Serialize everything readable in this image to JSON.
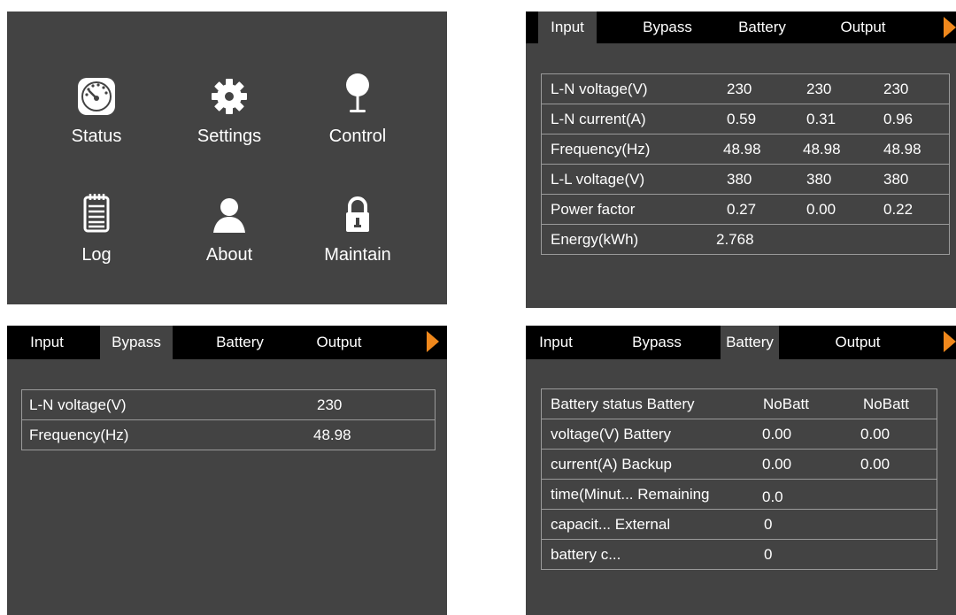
{
  "menu": {
    "items": [
      {
        "label": "Status",
        "icon": "gauge-icon"
      },
      {
        "label": "Settings",
        "icon": "gear-icon"
      },
      {
        "label": "Control",
        "icon": "joystick-icon"
      },
      {
        "label": "Log",
        "icon": "notepad-icon"
      },
      {
        "label": "About",
        "icon": "user-icon"
      },
      {
        "label": "Maintain",
        "icon": "lock-icon"
      }
    ]
  },
  "tabs": [
    "Input",
    "Bypass",
    "Battery",
    "Output"
  ],
  "accent_color": "#f0881c",
  "input_screen": {
    "active_tab": "Input",
    "rows": [
      {
        "label": "L-N voltage(V)",
        "values": [
          "230",
          "230",
          "230"
        ]
      },
      {
        "label": "L-N current(A)",
        "values": [
          "0.59",
          "0.31",
          "0.96"
        ]
      },
      {
        "label": "Frequency(Hz)",
        "values": [
          "48.98",
          "48.98",
          "48.98"
        ]
      },
      {
        "label": "L-L voltage(V)",
        "values": [
          "380",
          "380",
          "380"
        ]
      },
      {
        "label": "Power factor",
        "values": [
          "0.27",
          "0.00",
          "0.22"
        ]
      },
      {
        "label": "Energy(kWh)",
        "values": [
          "2.768",
          "",
          ""
        ]
      }
    ]
  },
  "bypass_screen": {
    "active_tab": "Bypass",
    "rows": [
      {
        "label": "L-N voltage(V)",
        "value": "230"
      },
      {
        "label": "Frequency(Hz)",
        "value": "48.98"
      }
    ]
  },
  "battery_screen": {
    "active_tab": "Battery",
    "rows": [
      {
        "label": "Battery status Battery",
        "values": [
          "NoBatt",
          "NoBatt"
        ]
      },
      {
        "label": "voltage(V) Battery",
        "values": [
          "0.00",
          "0.00"
        ]
      },
      {
        "label": "current(A) Backup",
        "values": [
          "0.00",
          "0.00"
        ]
      },
      {
        "label": "time(Minut... Remaining",
        "values": [
          "0.0",
          ""
        ]
      },
      {
        "label": "capacit... External",
        "values": [
          "0",
          ""
        ]
      },
      {
        "label": "battery c...",
        "values": [
          "0",
          ""
        ]
      }
    ]
  }
}
